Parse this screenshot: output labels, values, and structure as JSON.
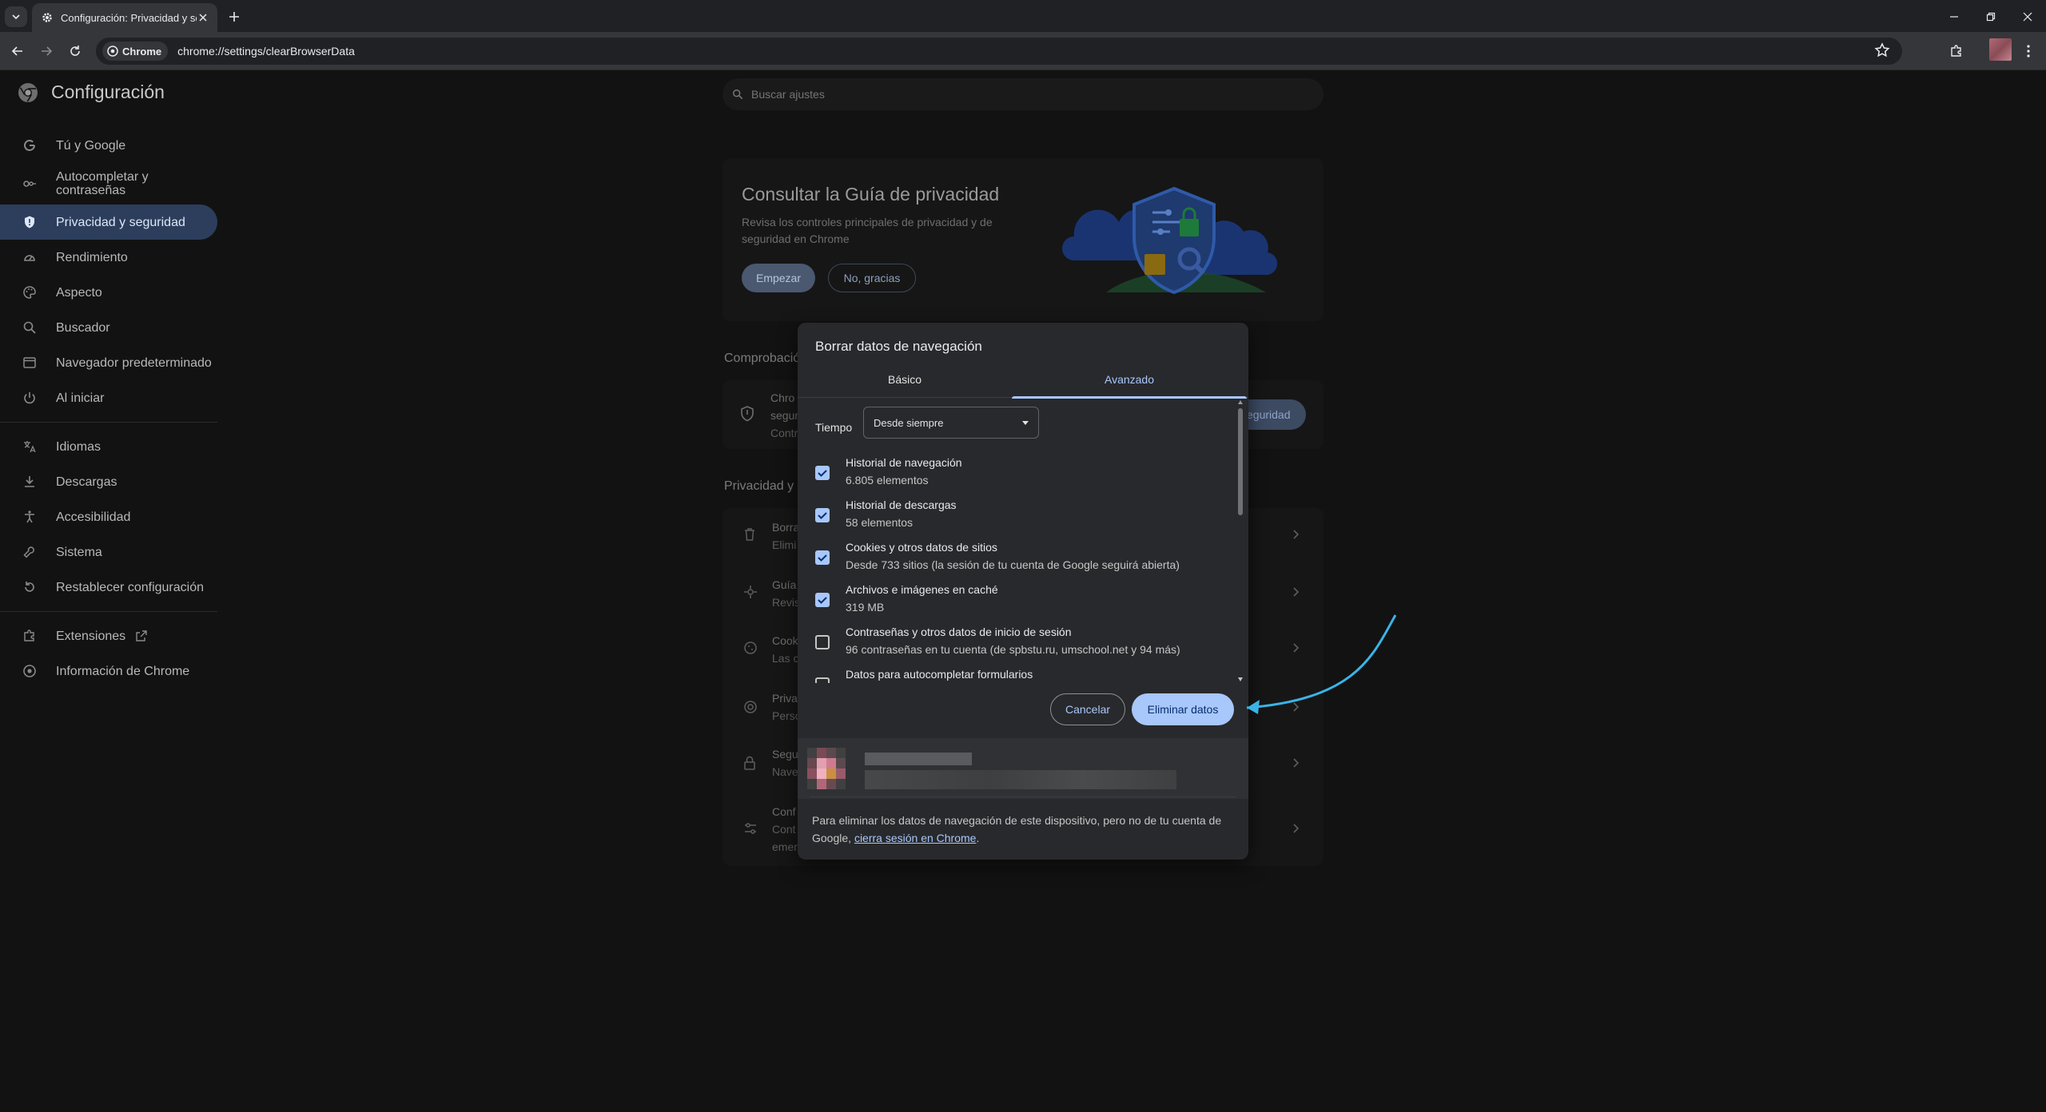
{
  "browser": {
    "tab_title": "Configuración: Privacidad y seg",
    "chip_label": "Chrome",
    "url": "chrome://settings/clearBrowserData"
  },
  "settings": {
    "title": "Configuración",
    "search_placeholder": "Buscar ajustes",
    "nav": [
      {
        "label": "Tú y Google",
        "icon": "google-icon"
      },
      {
        "label": "Autocompletar y contraseñas",
        "icon": "key-icon"
      },
      {
        "label": "Privacidad y seguridad",
        "icon": "shield-icon"
      },
      {
        "label": "Rendimiento",
        "icon": "speedometer-icon"
      },
      {
        "label": "Aspecto",
        "icon": "palette-icon"
      },
      {
        "label": "Buscador",
        "icon": "search-icon"
      },
      {
        "label": "Navegador predeterminado",
        "icon": "browser-icon"
      },
      {
        "label": "Al iniciar",
        "icon": "power-icon"
      },
      {
        "label": "Idiomas",
        "icon": "translate-icon"
      },
      {
        "label": "Descargas",
        "icon": "download-icon"
      },
      {
        "label": "Accesibilidad",
        "icon": "accessibility-icon"
      },
      {
        "label": "Sistema",
        "icon": "wrench-icon"
      },
      {
        "label": "Restablecer configuración",
        "icon": "reset-icon"
      },
      {
        "label": "Extensiones",
        "icon": "puzzle-icon"
      },
      {
        "label": "Información de Chrome",
        "icon": "chrome-icon"
      }
    ],
    "guide": {
      "title": "Consultar la Guía de privacidad",
      "description": "Revisa los controles principales de privacidad y de seguridad en Chrome",
      "start_label": "Empezar",
      "no_label": "No, gracias"
    },
    "bg_text": {
      "comprobacion": "Comprobació",
      "chrome_row1": "Chro",
      "chrome_row2": "segur",
      "chrome_row3": "Contr",
      "seg_button": "eguridad",
      "privacidad": "Privacidad y s",
      "rows": [
        {
          "l1": "Borra",
          "l2": "Elimi"
        },
        {
          "l1": "Guía",
          "l2": "Revis"
        },
        {
          "l1": "Cook",
          "l2": "Las c"
        },
        {
          "l1": "Priva",
          "l2": "Perso"
        },
        {
          "l1": "Segu",
          "l2": "Nave"
        },
        {
          "l1": "Conf",
          "l2": "Cont",
          "l3": "emer"
        }
      ]
    }
  },
  "dialog": {
    "title": "Borrar datos de navegación",
    "tab_basic": "Básico",
    "tab_advanced": "Avanzado",
    "time_label": "Tiempo",
    "time_value": "Desde siempre",
    "options": [
      {
        "label": "Historial de navegación",
        "sub": "6.805 elementos",
        "checked": true
      },
      {
        "label": "Historial de descargas",
        "sub": "58 elementos",
        "checked": true
      },
      {
        "label": "Cookies y otros datos de sitios",
        "sub": "Desde 733 sitios (la sesión de tu cuenta de Google seguirá abierta)",
        "checked": true
      },
      {
        "label": "Archivos e imágenes en caché",
        "sub": "319 MB",
        "checked": true
      },
      {
        "label": "Contraseñas y otros datos de inicio de sesión",
        "sub": "96 contraseñas en tu cuenta (de spbstu.ru, umschool.net y 94 más)",
        "checked": false
      },
      {
        "label": "Datos para autocompletar formularios",
        "sub": "",
        "checked": false
      }
    ],
    "cancel_label": "Cancelar",
    "delete_label": "Eliminar datos",
    "footer_text": "Para eliminar los datos de navegación de este dispositivo, pero no de tu cuenta de Google, ",
    "footer_link": "cierra sesión en Chrome",
    "footer_end": "."
  },
  "colors": {
    "accent": "#a8c7fa",
    "annotation_arrow": "#3ab4e6"
  }
}
